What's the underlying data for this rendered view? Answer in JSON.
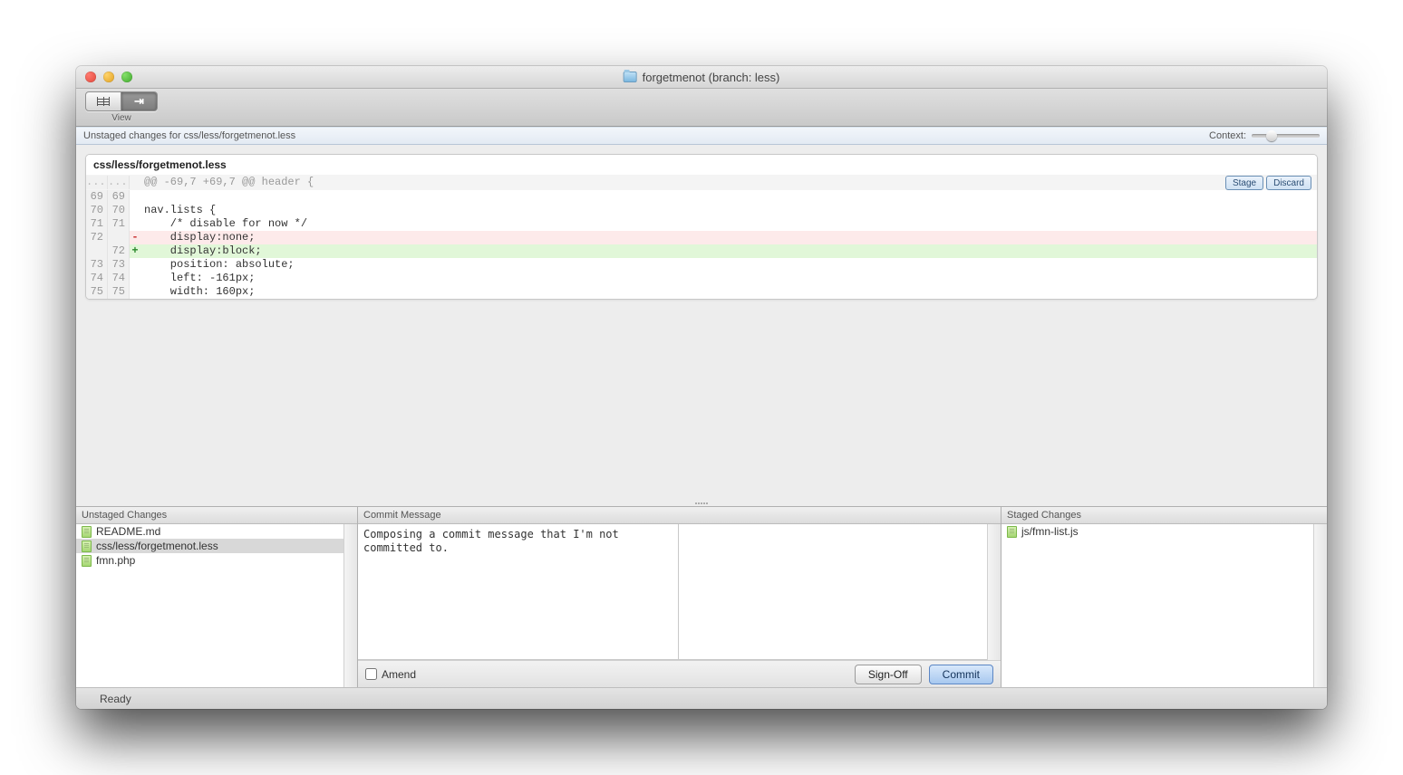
{
  "window": {
    "title": "forgetmenot (branch: less)"
  },
  "toolbar": {
    "view_label": "View"
  },
  "subheader": {
    "text": "Unstaged changes for css/less/forgetmenot.less",
    "context_label": "Context:"
  },
  "diff": {
    "file": "css/less/forgetmenot.less",
    "hunk_header": "@@ -69,7 +69,7 @@ header {",
    "stage_label": "Stage",
    "discard_label": "Discard",
    "rows": [
      {
        "old": "...",
        "new": "...",
        "type": "hunk"
      },
      {
        "old": "69",
        "new": "69",
        "type": "ctx",
        "code": ""
      },
      {
        "old": "70",
        "new": "70",
        "type": "ctx",
        "code": "nav.lists {"
      },
      {
        "old": "71",
        "new": "71",
        "type": "ctx",
        "code": "    /* disable for now */"
      },
      {
        "old": "72",
        "new": "",
        "type": "del",
        "code": "    display:none;"
      },
      {
        "old": "",
        "new": "72",
        "type": "add",
        "code": "    display:block;"
      },
      {
        "old": "73",
        "new": "73",
        "type": "ctx",
        "code": "    position: absolute;"
      },
      {
        "old": "74",
        "new": "74",
        "type": "ctx",
        "code": "    left: -161px;"
      },
      {
        "old": "75",
        "new": "75",
        "type": "ctx",
        "code": "    width: 160px;"
      }
    ]
  },
  "panels": {
    "unstaged_header": "Unstaged Changes",
    "commit_header": "Commit Message",
    "staged_header": "Staged Changes",
    "unstaged_files": [
      "README.md",
      "css/less/forgetmenot.less",
      "fmn.php"
    ],
    "unstaged_selected_index": 1,
    "staged_files": [
      "js/fmn-list.js"
    ]
  },
  "commit": {
    "message": "Composing a commit message that I'm not committed to.",
    "amend_label": "Amend",
    "signoff_label": "Sign-Off",
    "commit_label": "Commit"
  },
  "status": {
    "text": "Ready"
  }
}
